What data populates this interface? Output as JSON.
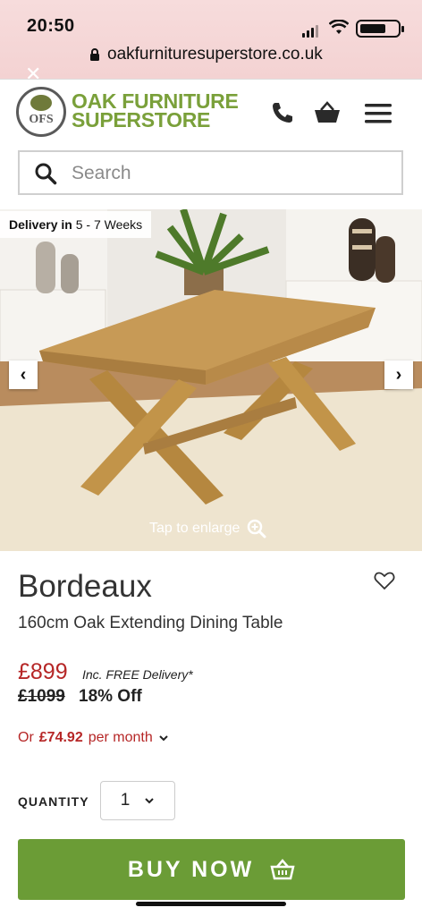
{
  "status_bar": {
    "time": "20:50",
    "url": "oakfurnituresuperstore.co.uk",
    "close": "✕"
  },
  "header": {
    "logo_line1": "OAK FURNITURE",
    "logo_line2": "SUPERSTORE",
    "logo_mark": "OFS",
    "icons": [
      "phone-icon",
      "basket-icon",
      "menu-icon"
    ]
  },
  "search": {
    "placeholder": "Search"
  },
  "gallery": {
    "delivery_label": "Delivery in",
    "delivery_value": "5 - 7 Weeks",
    "enlarge_text": "Tap to enlarge",
    "prev": "‹",
    "next": "›"
  },
  "product": {
    "title": "Bordeaux",
    "subtitle": "160cm Oak Extending Dining Table",
    "price": "£899",
    "free_delivery": "Inc. FREE Delivery*",
    "was_price": "£1099",
    "discount": "18% Off",
    "finance_prefix": "Or",
    "finance_amount": "£74.92",
    "finance_suffix": "per month"
  },
  "quantity": {
    "label": "QUANTITY",
    "value": "1"
  },
  "buy_button": {
    "label": "BUY NOW"
  },
  "colors": {
    "accent_green": "#6b9c36",
    "price_red": "#b62727",
    "logo_green": "#7aa03a"
  }
}
